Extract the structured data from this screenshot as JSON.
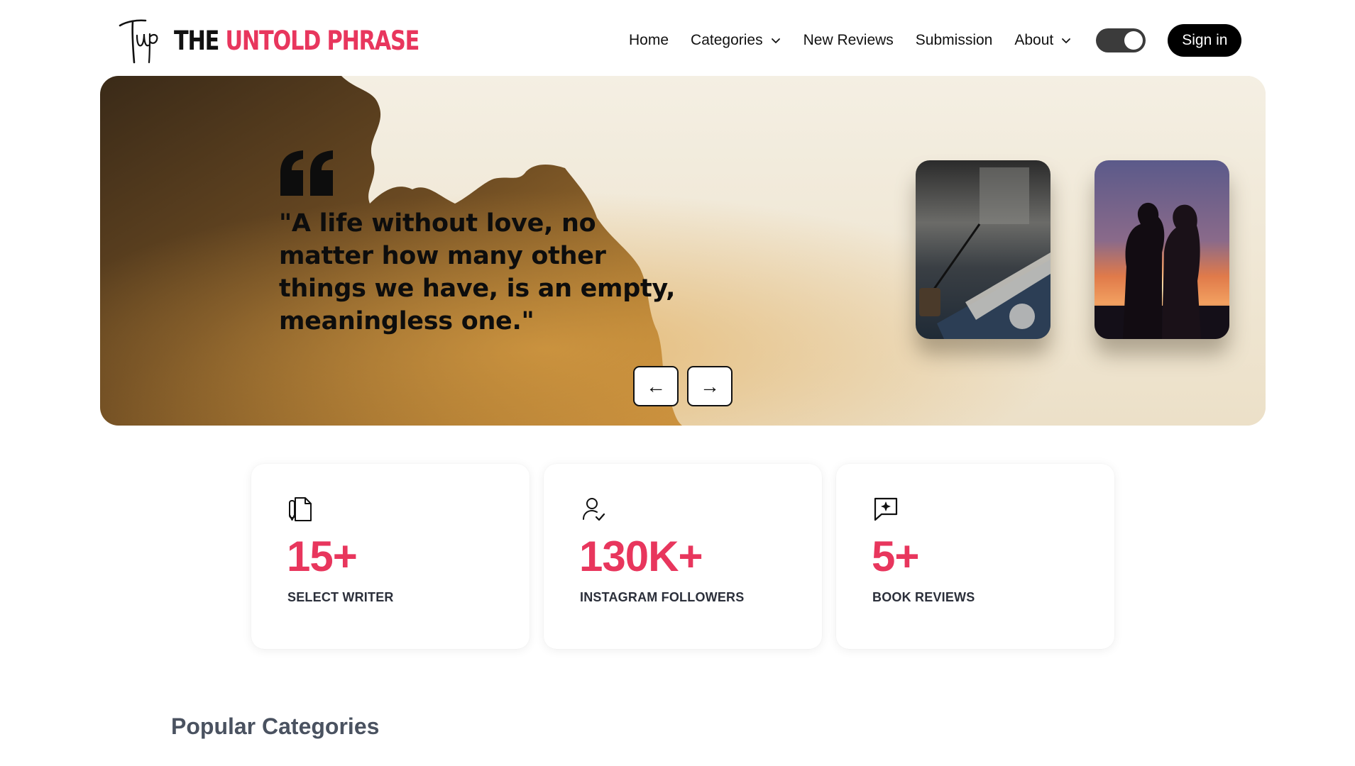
{
  "brand": {
    "logo_mark_text": "Tup",
    "name_part1": "THE",
    "name_part2": "UNTOLD PHRASE",
    "accent_color": "#e8365d"
  },
  "nav": {
    "items": [
      {
        "label": "Home",
        "has_dropdown": false
      },
      {
        "label": "Categories",
        "has_dropdown": true
      },
      {
        "label": "New Reviews",
        "has_dropdown": false
      },
      {
        "label": "Submission",
        "has_dropdown": false
      },
      {
        "label": "About",
        "has_dropdown": true
      }
    ],
    "theme_toggle": {
      "state": "on",
      "icon": "toggle-switch-icon"
    },
    "signin_label": "Sign in"
  },
  "hero": {
    "quote_icon": "quote-icon",
    "quote": "\"A life without love, no matter how many other things we have, is an empty, meaningless one.\"",
    "prev_label": "←",
    "next_label": "→",
    "cards": [
      {
        "name": "writing-desk-photo"
      },
      {
        "name": "couple-sunset-photo"
      }
    ]
  },
  "stats": [
    {
      "icon": "document-pen-icon",
      "value": "15+",
      "label": "SELECT WRITER"
    },
    {
      "icon": "user-check-icon",
      "value": "130K+",
      "label": "INSTAGRAM FOLLOWERS"
    },
    {
      "icon": "message-sparkle-icon",
      "value": "5+",
      "label": "BOOK REVIEWS"
    }
  ],
  "sections": {
    "popular_categories_title": "Popular Categories"
  }
}
